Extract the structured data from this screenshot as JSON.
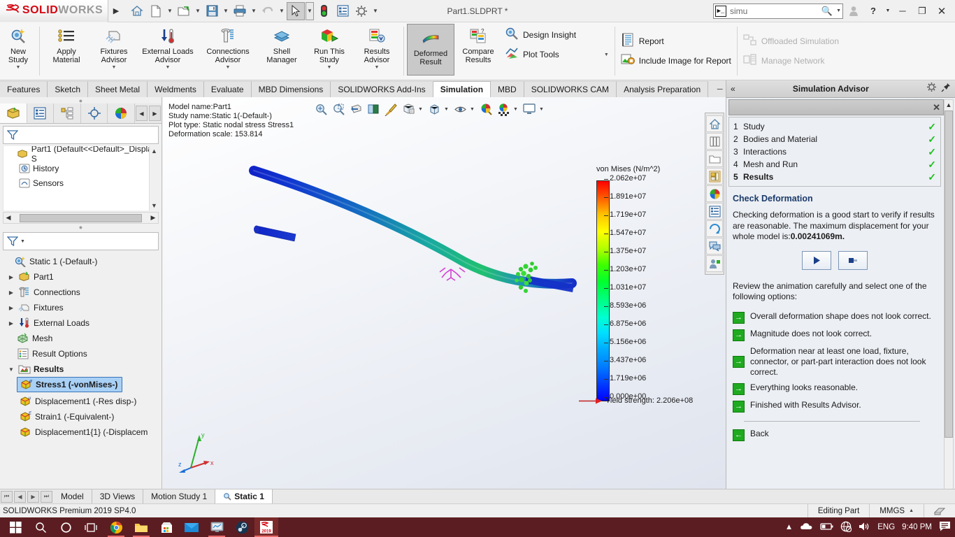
{
  "titlebar": {
    "brand_ds": "3DS",
    "brand_main": "SOLID",
    "brand_sub": "WORKS",
    "doc_title": "Part1.SLDPRT *",
    "search": {
      "value": "simu",
      "placeholder": "Search"
    },
    "icons": [
      "home-icon",
      "new-document-icon",
      "open-folder-icon",
      "save-icon",
      "print-icon",
      "undo-icon",
      "select-arrow-icon",
      "traffic-light-icon",
      "options-list-icon",
      "gear-icon"
    ],
    "window_buttons": [
      "user-icon",
      "help-icon",
      "minimize-icon",
      "restore-icon",
      "close-icon"
    ]
  },
  "ribbon": {
    "buttons": [
      {
        "label": "New\nStudy",
        "name": "new-study",
        "dropdown": true,
        "icon": "new-study-icon"
      },
      {
        "label": "Apply\nMaterial",
        "name": "apply-material",
        "dropdown": false,
        "icon": "apply-material-icon"
      },
      {
        "label": "Fixtures\nAdvisor",
        "name": "fixtures-advisor",
        "dropdown": true,
        "icon": "fixtures-icon"
      },
      {
        "label": "External Loads\nAdvisor",
        "name": "external-loads-advisor",
        "dropdown": true,
        "icon": "external-loads-icon"
      },
      {
        "label": "Connections\nAdvisor",
        "name": "connections-advisor",
        "dropdown": true,
        "icon": "connections-icon"
      },
      {
        "label": "Shell\nManager",
        "name": "shell-manager",
        "dropdown": false,
        "icon": "shell-manager-icon"
      },
      {
        "label": "Run This\nStudy",
        "name": "run-this-study",
        "dropdown": true,
        "icon": "run-study-icon"
      },
      {
        "label": "Results\nAdvisor",
        "name": "results-advisor",
        "dropdown": true,
        "icon": "results-advisor-icon"
      },
      {
        "label": "Deformed\nResult",
        "name": "deformed-result",
        "dropdown": false,
        "icon": "deformed-result-icon",
        "active": true
      },
      {
        "label": "Compare\nResults",
        "name": "compare-results",
        "dropdown": false,
        "icon": "compare-results-icon"
      }
    ],
    "list_group_1": [
      {
        "label": "Design Insight",
        "name": "design-insight",
        "icon": "design-insight-icon",
        "dimmed": false,
        "caret": false
      },
      {
        "label": "Plot Tools",
        "name": "plot-tools",
        "icon": "plot-tools-icon",
        "dimmed": false,
        "caret": true
      }
    ],
    "list_group_2": [
      {
        "label": "Report",
        "name": "report",
        "icon": "report-icon",
        "dimmed": false,
        "caret": false
      },
      {
        "label": "Include Image for Report",
        "name": "include-image-for-report",
        "icon": "include-image-icon",
        "dimmed": false,
        "caret": false
      }
    ],
    "list_group_3": [
      {
        "label": "Offloaded Simulation",
        "name": "offloaded-simulation",
        "icon": "offloaded-simulation-icon",
        "dimmed": true,
        "caret": false
      },
      {
        "label": "Manage Network",
        "name": "manage-network",
        "icon": "manage-network-icon",
        "dimmed": true,
        "caret": false
      }
    ]
  },
  "tabs": [
    {
      "label": "Features",
      "name": "tab-features",
      "active": false
    },
    {
      "label": "Sketch",
      "name": "tab-sketch",
      "active": false
    },
    {
      "label": "Sheet Metal",
      "name": "tab-sheet-metal",
      "active": false
    },
    {
      "label": "Weldments",
      "name": "tab-weldments",
      "active": false
    },
    {
      "label": "Evaluate",
      "name": "tab-evaluate",
      "active": false
    },
    {
      "label": "MBD Dimensions",
      "name": "tab-mbd-dimensions",
      "active": false
    },
    {
      "label": "SOLIDWORKS Add-Ins",
      "name": "tab-solidworks-add-ins",
      "active": false
    },
    {
      "label": "Simulation",
      "name": "tab-simulation",
      "active": true
    },
    {
      "label": "MBD",
      "name": "tab-mbd",
      "active": false
    },
    {
      "label": "SOLIDWORKS CAM",
      "name": "tab-solidworks-cam",
      "active": false
    },
    {
      "label": "Analysis Preparation",
      "name": "tab-analysis-preparation",
      "active": false
    }
  ],
  "feature_tree": {
    "tabs": [
      "feature-manager-icon",
      "property-manager-icon",
      "configuration-manager-icon",
      "dimxpert-icon",
      "display-manager-icon"
    ],
    "rows": [
      {
        "label": "Part1  (Default<<Default>_Display S",
        "icon": "part-icon",
        "indent": 0,
        "expander": ""
      },
      {
        "label": "History",
        "icon": "history-icon",
        "indent": 1,
        "expander": ""
      },
      {
        "label": "Sensors",
        "icon": "sensors-icon",
        "indent": 1,
        "expander": ""
      }
    ]
  },
  "simulation_tree": {
    "rows": [
      {
        "label": "Static 1 (-Default-)",
        "icon": "study-icon",
        "indent": 0,
        "expander": "",
        "bold": false,
        "selected": false
      },
      {
        "label": "Part1",
        "icon": "part-icon",
        "indent": 1,
        "expander": "▸",
        "bold": false,
        "selected": false
      },
      {
        "label": "Connections",
        "icon": "connections-icon",
        "indent": 1,
        "expander": "▸",
        "bold": false,
        "selected": false
      },
      {
        "label": "Fixtures",
        "icon": "fixtures-icon",
        "indent": 1,
        "expander": "▸",
        "bold": false,
        "selected": false
      },
      {
        "label": "External Loads",
        "icon": "external-loads-icon",
        "indent": 1,
        "expander": "▸",
        "bold": false,
        "selected": false
      },
      {
        "label": "Mesh",
        "icon": "mesh-icon",
        "indent": 1,
        "expander": "",
        "bold": false,
        "selected": false
      },
      {
        "label": "Result Options",
        "icon": "result-options-icon",
        "indent": 1,
        "expander": "",
        "bold": false,
        "selected": false
      },
      {
        "label": "Results",
        "icon": "results-folder-icon",
        "indent": 1,
        "expander": "▾",
        "bold": true,
        "selected": false
      },
      {
        "label": "Stress1 (-vonMises-)",
        "icon": "plot-stress-icon",
        "indent": 2,
        "expander": "",
        "bold": true,
        "selected": true
      },
      {
        "label": "Displacement1 (-Res disp-)",
        "icon": "plot-displacement-icon",
        "indent": 2,
        "expander": "",
        "bold": false,
        "selected": false
      },
      {
        "label": "Strain1 (-Equivalent-)",
        "icon": "plot-strain-icon",
        "indent": 2,
        "expander": "",
        "bold": false,
        "selected": false
      },
      {
        "label": "Displacement1{1} (-Displacem",
        "icon": "plot-displacement-icon",
        "indent": 2,
        "expander": "",
        "bold": false,
        "selected": false
      }
    ]
  },
  "graphics": {
    "header": [
      "Model name:Part1",
      "Study name:Static 1(-Default-)",
      "Plot type: Static nodal stress Stress1",
      "Deformation scale: 153.814"
    ],
    "toolbar_icons": [
      "zoom-to-fit-icon",
      "zoom-to-area-icon",
      "section-view-icon",
      "view-orientation-icon",
      "display-style-icon",
      "hide-show-icon",
      "edit-appearance-icon",
      "apply-scene-icon",
      "view-settings-icon"
    ],
    "view_toolbar_icons": [
      "home-icon",
      "design-library-icon",
      "file-explorer-icon",
      "view-palette-icon",
      "appearances-icon",
      "custom-properties-icon",
      "3dexperience-icon",
      "forum-icon",
      "user-portal-icon"
    ],
    "triad_labels": [
      "z",
      "y",
      "x"
    ]
  },
  "chart_data": {
    "type": "colorbar",
    "title": "von Mises (N/m^2)",
    "unit": "N/m^2",
    "ticks": [
      "2.062e+07",
      "1.891e+07",
      "1.719e+07",
      "1.547e+07",
      "1.375e+07",
      "1.203e+07",
      "1.031e+07",
      "8.593e+06",
      "6.875e+06",
      "5.156e+06",
      "3.437e+06",
      "1.719e+06",
      "0.000e+00"
    ],
    "values": [
      20620000,
      18910000,
      17190000,
      15470000,
      13750000,
      12030000,
      10310000,
      8593000,
      6875000,
      5156000,
      3437000,
      1719000,
      0
    ],
    "min": 0,
    "max": 20620000,
    "colormap": [
      "#0000ff",
      "#00ffff",
      "#00ff00",
      "#ffff00",
      "#ff0000"
    ],
    "annotation": {
      "label": "Yield strength:",
      "value": "2.206e+08",
      "full": "Yield strength: 2.206e+08"
    }
  },
  "advisor": {
    "panel_title": "Simulation Advisor",
    "steps": [
      {
        "num": "1",
        "label": "Study",
        "checked": true,
        "current": false
      },
      {
        "num": "2",
        "label": "Bodies and Material",
        "checked": true,
        "current": false
      },
      {
        "num": "3",
        "label": "Interactions",
        "checked": true,
        "current": false
      },
      {
        "num": "4",
        "label": "Mesh and Run",
        "checked": true,
        "current": false
      },
      {
        "num": "5",
        "label": "Results",
        "checked": true,
        "current": true
      }
    ],
    "heading": "Check Deformation",
    "body_text": "Checking deformation is a good start to verify if results are reasonable. The maximum displacement for your whole model is:",
    "body_bold": "0.00241069m.",
    "review_text": "Review the animation carefully and select one of the following options:",
    "play_button": "play-icon",
    "stop_button": "stop-icon",
    "options": [
      "Overall deformation shape does not look correct.",
      "Magnitude does not look correct.",
      "Deformation near at least one load, fixture, connector, or part-part interaction does not look correct.",
      "Everything looks reasonable.",
      "Finished with Results Advisor."
    ],
    "back_label": "Back"
  },
  "doc_tabs": [
    {
      "label": "Model",
      "name": "doc-tab-model",
      "active": false
    },
    {
      "label": "3D Views",
      "name": "doc-tab-3d-views",
      "active": false
    },
    {
      "label": "Motion Study 1",
      "name": "doc-tab-motion-study-1",
      "active": false
    },
    {
      "label": "Static 1",
      "name": "doc-tab-static-1",
      "active": true
    }
  ],
  "statusbar": {
    "left": "SOLIDWORKS Premium 2019 SP4.0",
    "editing": "Editing Part",
    "units": "MMGS"
  },
  "taskbar": {
    "items": [
      "start-icon",
      "search-icon",
      "cortana-icon",
      "task-view-icon",
      "chrome-icon",
      "file-explorer-icon",
      "microsoft-store-icon",
      "mail-icon",
      "monitor-app-icon",
      "steam-icon",
      "solidworks-2019-icon"
    ],
    "tray": {
      "chevron": "show-hidden-icons",
      "icons": [
        "cloud-icon",
        "battery-icon",
        "network-icon",
        "volume-icon"
      ],
      "language": "ENG",
      "time": "9:40 PM",
      "action_center": "notifications-icon"
    }
  }
}
